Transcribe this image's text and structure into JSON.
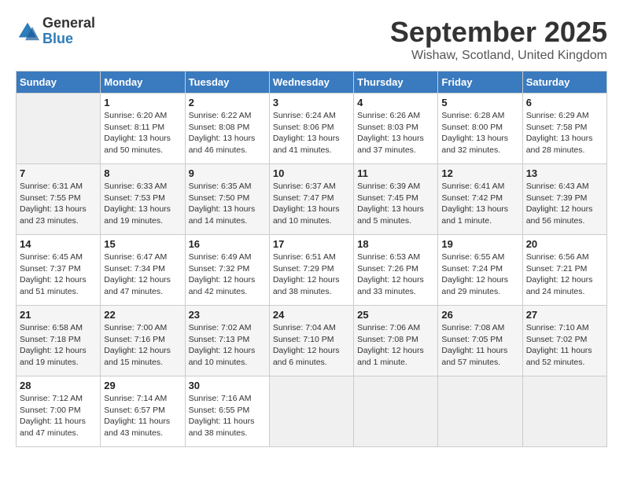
{
  "header": {
    "logo": {
      "general": "General",
      "blue": "Blue"
    },
    "title": "September 2025",
    "subtitle": "Wishaw, Scotland, United Kingdom"
  },
  "weekdays": [
    "Sunday",
    "Monday",
    "Tuesday",
    "Wednesday",
    "Thursday",
    "Friday",
    "Saturday"
  ],
  "weeks": [
    [
      {
        "day": "",
        "sunrise": "",
        "sunset": "",
        "daylight": ""
      },
      {
        "day": "1",
        "sunrise": "Sunrise: 6:20 AM",
        "sunset": "Sunset: 8:11 PM",
        "daylight": "Daylight: 13 hours and 50 minutes."
      },
      {
        "day": "2",
        "sunrise": "Sunrise: 6:22 AM",
        "sunset": "Sunset: 8:08 PM",
        "daylight": "Daylight: 13 hours and 46 minutes."
      },
      {
        "day": "3",
        "sunrise": "Sunrise: 6:24 AM",
        "sunset": "Sunset: 8:06 PM",
        "daylight": "Daylight: 13 hours and 41 minutes."
      },
      {
        "day": "4",
        "sunrise": "Sunrise: 6:26 AM",
        "sunset": "Sunset: 8:03 PM",
        "daylight": "Daylight: 13 hours and 37 minutes."
      },
      {
        "day": "5",
        "sunrise": "Sunrise: 6:28 AM",
        "sunset": "Sunset: 8:00 PM",
        "daylight": "Daylight: 13 hours and 32 minutes."
      },
      {
        "day": "6",
        "sunrise": "Sunrise: 6:29 AM",
        "sunset": "Sunset: 7:58 PM",
        "daylight": "Daylight: 13 hours and 28 minutes."
      }
    ],
    [
      {
        "day": "7",
        "sunrise": "Sunrise: 6:31 AM",
        "sunset": "Sunset: 7:55 PM",
        "daylight": "Daylight: 13 hours and 23 minutes."
      },
      {
        "day": "8",
        "sunrise": "Sunrise: 6:33 AM",
        "sunset": "Sunset: 7:53 PM",
        "daylight": "Daylight: 13 hours and 19 minutes."
      },
      {
        "day": "9",
        "sunrise": "Sunrise: 6:35 AM",
        "sunset": "Sunset: 7:50 PM",
        "daylight": "Daylight: 13 hours and 14 minutes."
      },
      {
        "day": "10",
        "sunrise": "Sunrise: 6:37 AM",
        "sunset": "Sunset: 7:47 PM",
        "daylight": "Daylight: 13 hours and 10 minutes."
      },
      {
        "day": "11",
        "sunrise": "Sunrise: 6:39 AM",
        "sunset": "Sunset: 7:45 PM",
        "daylight": "Daylight: 13 hours and 5 minutes."
      },
      {
        "day": "12",
        "sunrise": "Sunrise: 6:41 AM",
        "sunset": "Sunset: 7:42 PM",
        "daylight": "Daylight: 13 hours and 1 minute."
      },
      {
        "day": "13",
        "sunrise": "Sunrise: 6:43 AM",
        "sunset": "Sunset: 7:39 PM",
        "daylight": "Daylight: 12 hours and 56 minutes."
      }
    ],
    [
      {
        "day": "14",
        "sunrise": "Sunrise: 6:45 AM",
        "sunset": "Sunset: 7:37 PM",
        "daylight": "Daylight: 12 hours and 51 minutes."
      },
      {
        "day": "15",
        "sunrise": "Sunrise: 6:47 AM",
        "sunset": "Sunset: 7:34 PM",
        "daylight": "Daylight: 12 hours and 47 minutes."
      },
      {
        "day": "16",
        "sunrise": "Sunrise: 6:49 AM",
        "sunset": "Sunset: 7:32 PM",
        "daylight": "Daylight: 12 hours and 42 minutes."
      },
      {
        "day": "17",
        "sunrise": "Sunrise: 6:51 AM",
        "sunset": "Sunset: 7:29 PM",
        "daylight": "Daylight: 12 hours and 38 minutes."
      },
      {
        "day": "18",
        "sunrise": "Sunrise: 6:53 AM",
        "sunset": "Sunset: 7:26 PM",
        "daylight": "Daylight: 12 hours and 33 minutes."
      },
      {
        "day": "19",
        "sunrise": "Sunrise: 6:55 AM",
        "sunset": "Sunset: 7:24 PM",
        "daylight": "Daylight: 12 hours and 29 minutes."
      },
      {
        "day": "20",
        "sunrise": "Sunrise: 6:56 AM",
        "sunset": "Sunset: 7:21 PM",
        "daylight": "Daylight: 12 hours and 24 minutes."
      }
    ],
    [
      {
        "day": "21",
        "sunrise": "Sunrise: 6:58 AM",
        "sunset": "Sunset: 7:18 PM",
        "daylight": "Daylight: 12 hours and 19 minutes."
      },
      {
        "day": "22",
        "sunrise": "Sunrise: 7:00 AM",
        "sunset": "Sunset: 7:16 PM",
        "daylight": "Daylight: 12 hours and 15 minutes."
      },
      {
        "day": "23",
        "sunrise": "Sunrise: 7:02 AM",
        "sunset": "Sunset: 7:13 PM",
        "daylight": "Daylight: 12 hours and 10 minutes."
      },
      {
        "day": "24",
        "sunrise": "Sunrise: 7:04 AM",
        "sunset": "Sunset: 7:10 PM",
        "daylight": "Daylight: 12 hours and 6 minutes."
      },
      {
        "day": "25",
        "sunrise": "Sunrise: 7:06 AM",
        "sunset": "Sunset: 7:08 PM",
        "daylight": "Daylight: 12 hours and 1 minute."
      },
      {
        "day": "26",
        "sunrise": "Sunrise: 7:08 AM",
        "sunset": "Sunset: 7:05 PM",
        "daylight": "Daylight: 11 hours and 57 minutes."
      },
      {
        "day": "27",
        "sunrise": "Sunrise: 7:10 AM",
        "sunset": "Sunset: 7:02 PM",
        "daylight": "Daylight: 11 hours and 52 minutes."
      }
    ],
    [
      {
        "day": "28",
        "sunrise": "Sunrise: 7:12 AM",
        "sunset": "Sunset: 7:00 PM",
        "daylight": "Daylight: 11 hours and 47 minutes."
      },
      {
        "day": "29",
        "sunrise": "Sunrise: 7:14 AM",
        "sunset": "Sunset: 6:57 PM",
        "daylight": "Daylight: 11 hours and 43 minutes."
      },
      {
        "day": "30",
        "sunrise": "Sunrise: 7:16 AM",
        "sunset": "Sunset: 6:55 PM",
        "daylight": "Daylight: 11 hours and 38 minutes."
      },
      {
        "day": "",
        "sunrise": "",
        "sunset": "",
        "daylight": ""
      },
      {
        "day": "",
        "sunrise": "",
        "sunset": "",
        "daylight": ""
      },
      {
        "day": "",
        "sunrise": "",
        "sunset": "",
        "daylight": ""
      },
      {
        "day": "",
        "sunrise": "",
        "sunset": "",
        "daylight": ""
      }
    ]
  ]
}
